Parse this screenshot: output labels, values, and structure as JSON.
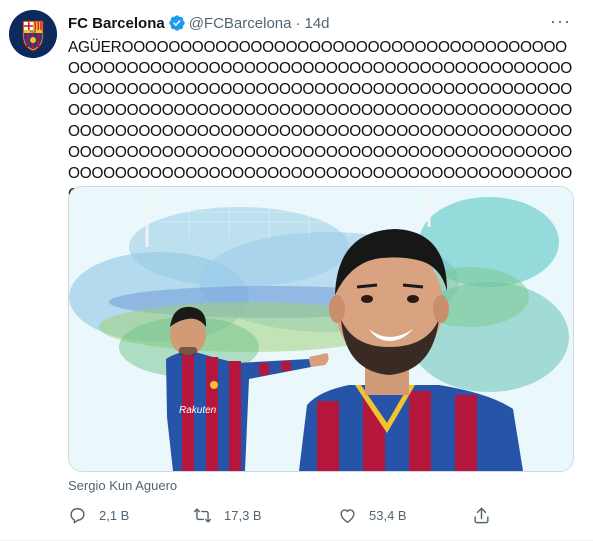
{
  "tweet": {
    "author_name": "FC Barcelona",
    "author_handle": "@FCBarcelona",
    "separator": "·",
    "time": "14d",
    "more_label": "···",
    "text": "AGÜEROOOOOOOOOOOOOOOOOOOOOOOOOOOOOOOOOOOOOOOOOOOOOOOOOOOOOOOOOOOOOOOOOOOOOOOOOOOOOOOOOOOOOOOOOOOOOOOOOOOOOOOOOOOOOOOOOOOOOOOOOOOOOOOOOOOOOOOOOOOOOOOOOOOOOOOOOOOOOOOOOOOOOOOOOOOOOOOOOOOOOOOOOOOOOOOOOOOOOOOOOOOOOOOOOOOOOOOOOOOOOOOOOOOOOOOOOOOOOOOOOOOOOOOOOOOOOOOOOOOOOOOOOOOOOOOOOOOOOOOOOOOOOOOOOOOOOOOOOOOOOOOOOO!",
    "media_caption": "Sergio Kun Aguero",
    "replies": "2,1 B",
    "retweets": "17,3 B",
    "likes": "53,4 B"
  },
  "icons": {
    "verified": "verified-badge-icon",
    "reply": "reply-icon",
    "retweet": "retweet-icon",
    "like": "heart-icon",
    "share": "share-icon"
  },
  "colors": {
    "text": "#0f1419",
    "secondary": "#536471",
    "verified": "#1d9bf0",
    "border": "#cfd9de"
  }
}
